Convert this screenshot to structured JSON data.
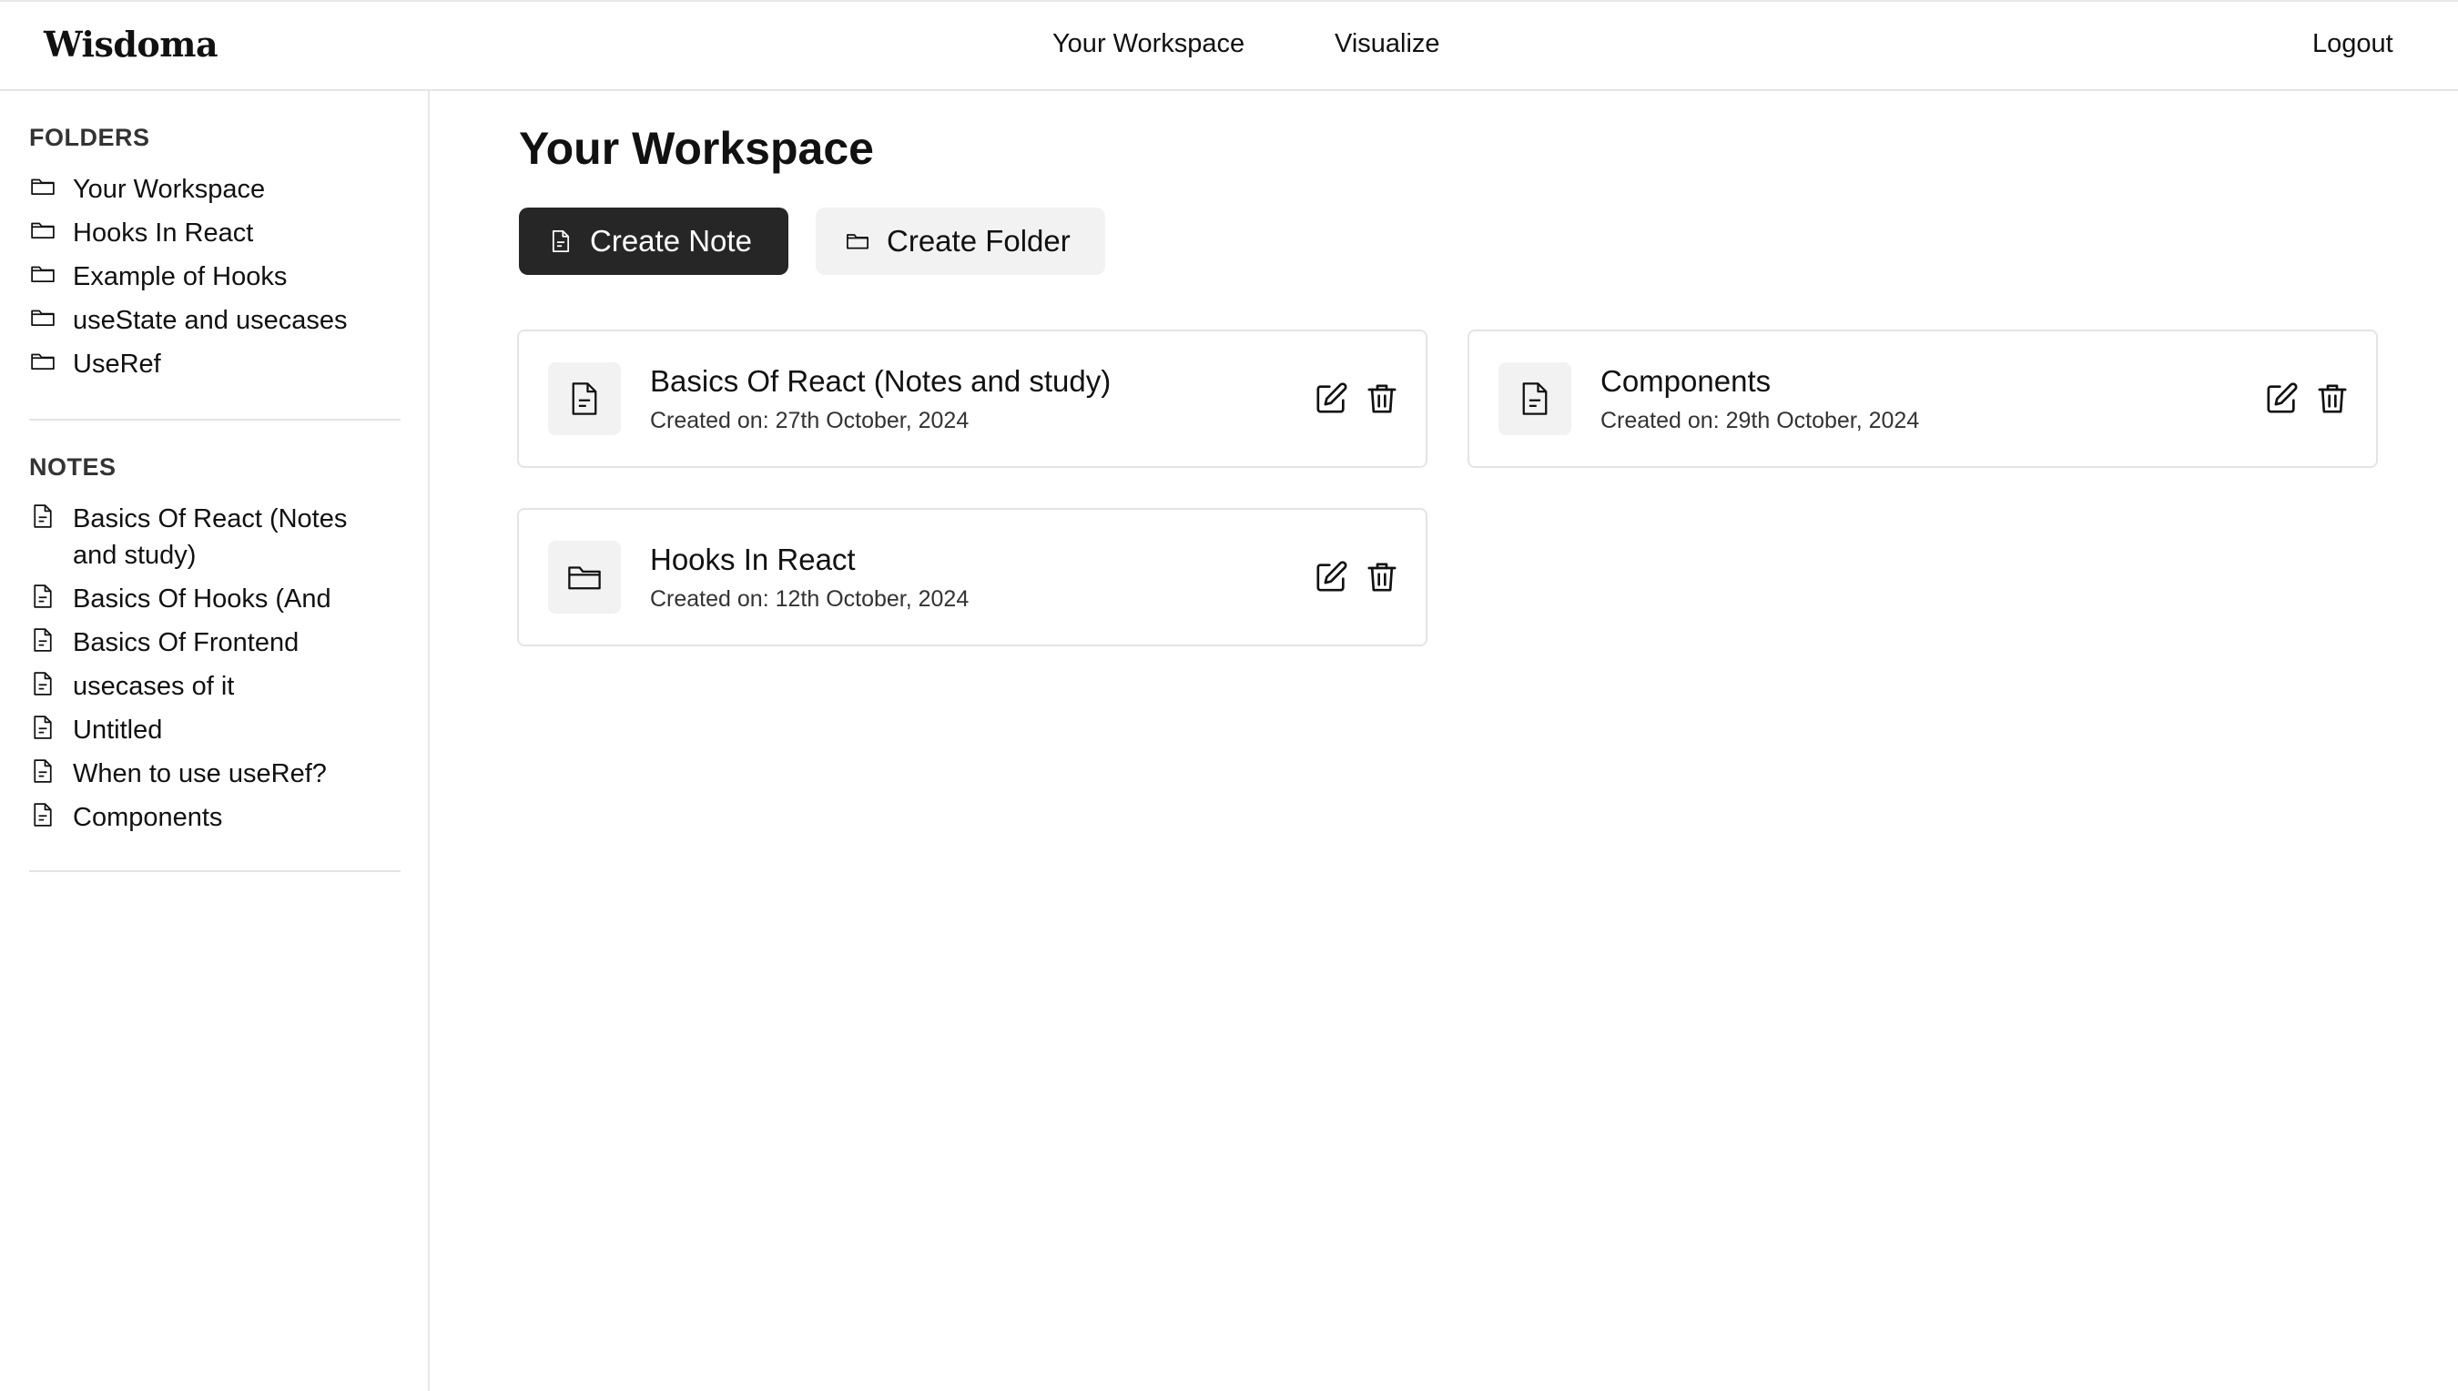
{
  "app": {
    "brand": "Wisdoma",
    "nav": {
      "workspace": "Your Workspace",
      "visualize": "Visualize",
      "logout": "Logout"
    }
  },
  "sidebar": {
    "folders_title": "FOLDERS",
    "folders": [
      {
        "label": "Your Workspace",
        "icon": "folder-icon"
      },
      {
        "label": "Hooks In React",
        "icon": "folder-icon"
      },
      {
        "label": "Example of Hooks",
        "icon": "folder-icon"
      },
      {
        "label": "useState and usecases",
        "icon": "folder-icon"
      },
      {
        "label": "UseRef",
        "icon": "folder-icon"
      }
    ],
    "notes_title": "NOTES",
    "notes": [
      {
        "label": "Basics Of React (Notes and study)",
        "icon": "file-icon"
      },
      {
        "label": "Basics Of Hooks (And",
        "icon": "file-icon"
      },
      {
        "label": "Basics Of Frontend",
        "icon": "file-icon"
      },
      {
        "label": "usecases of it",
        "icon": "file-icon"
      },
      {
        "label": "Untitled",
        "icon": "file-icon"
      },
      {
        "label": "When to use useRef?",
        "icon": "file-icon"
      },
      {
        "label": "Components",
        "icon": "file-icon"
      }
    ]
  },
  "main": {
    "title": "Your Workspace",
    "create_note_label": "Create Note",
    "create_folder_label": "Create Folder",
    "cards": [
      {
        "type": "note",
        "icon": "file-icon",
        "title": "Basics Of React (Notes and study)",
        "date": "Created on: 27th October, 2024"
      },
      {
        "type": "note",
        "icon": "file-icon",
        "title": "Components",
        "date": "Created on: 29th October, 2024"
      },
      {
        "type": "folder",
        "icon": "folder-icon",
        "title": "Hooks In React",
        "date": "Created on: 12th October, 2024"
      }
    ]
  },
  "colors": {
    "primary_button": "#262626",
    "secondary_button": "#f2f2f2",
    "border": "#e4e4e4",
    "text": "#111111"
  }
}
